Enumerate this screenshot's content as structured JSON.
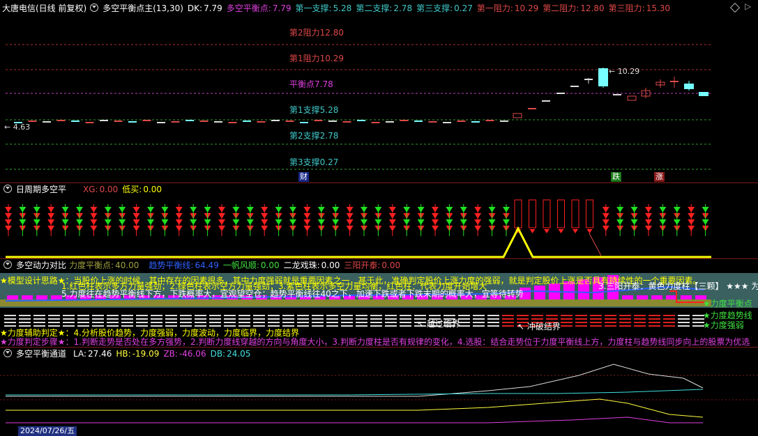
{
  "main_panel": {
    "title": "大唐电信(日线 前复权)",
    "indicator": "多空平衡点主(13,30)",
    "dk_label": "DK:",
    "dk_value": "7.79",
    "balance_label": "多空平衡点:",
    "balance_value": "7.79",
    "s1_label": "第一支撑:",
    "s1_value": "5.28",
    "s2_label": "第二支撑:",
    "s2_value": "2.78",
    "s3_label": "第三支撑:",
    "s3_value": "0.27",
    "r1_label": "第一阻力:",
    "r1_value": "10.29",
    "r2_label": "第二阻力:",
    "r2_value": "12.80",
    "r3_label": "第三阻力:",
    "r3_value": "15.30",
    "level_r2": "第2阻力12.80",
    "level_r1": "第1阻力10.29",
    "level_balance": "平衡点7.78",
    "level_s1": "第1支撑5.28",
    "level_s2": "第2支撑2.78",
    "level_s3": "第3支撑0.27",
    "low_mark": "← 4.63",
    "high_mark": "← 10.29",
    "tag_cai": "财",
    "tag_die": "跌",
    "tag_zhang": "涨",
    "colors": {
      "red": "#e04848",
      "cyan": "#40c8c8",
      "magenta": "#e040e0",
      "yellow": "#ffff00"
    }
  },
  "period_panel": {
    "title": "日周期多空平",
    "xg_label": "XG:",
    "xg_value": "0.00",
    "low_buy_label": "低买:",
    "low_buy_value": "0.00"
  },
  "power_panel": {
    "title": "多空动力对比",
    "force_label": "力度平衡点:",
    "force_value": "40.00",
    "trend_label": "趋势平衡线:",
    "trend_value": "64.49",
    "yifan_label": "一帆风顺:",
    "yifan_value": "0.00",
    "erlong_label": "二龙戏珠:",
    "erlong_value": "0.00",
    "sanyang_label": "三阳开泰:",
    "sanyang_value": "0.00",
    "text1": "★模型设计思路★：当股价上涨的时候，其中存在的因素很多，其中力度强弱就是重要因素之一，甚于此，准确判定股价上涨力度的强弱，就是判定股价上涨是否具有持续性的一个重要因素。",
    "text2": "1.红色柱表示多方力量强劲；2.绿色柱表示空方力量强劲；3.紫色柱表示多空力量均衡，红色柱：代表力度开始增大",
    "text3": "5.力度往在趋势平衡线下方，下跌概率大，宜观望空仓；趋势平衡线往40之下，加速下跌或者下跌末期的概率大，宜等待转势",
    "text4": "3.三阳开泰：黄色力度柱【三颗】 ★★★ 为",
    "legend1": "★力度平衡点",
    "legend2": "★力度趋势线",
    "legend3": "★力度强弱",
    "break_label": "↖ 越过临界",
    "breakout_label": "↖ 冲破结界",
    "text5": "★力度辅助判定★：4.分析股价趋势，力度强弱，力度波动，力度临界，力度结界",
    "text6": "★力度判定步骤★：1.判断走势是否处在多方强势，2.判断力度线穿越的方向与角度大小，3.判断力度柱是否有规律的变化，4.选股：结合走势位于力度平衡线上方，力度柱与趋势线同步向上的股票为优选"
  },
  "channel_panel": {
    "title": "多空平衡通道",
    "la_label": "LA:",
    "la_value": "27.46",
    "hb_label": "HB:",
    "hb_value": "-19.09",
    "zb_label": "ZB:",
    "zb_value": "-46.06",
    "db_label": "DB:",
    "db_value": "24.05",
    "date_label": "2024/07/26/五"
  }
}
